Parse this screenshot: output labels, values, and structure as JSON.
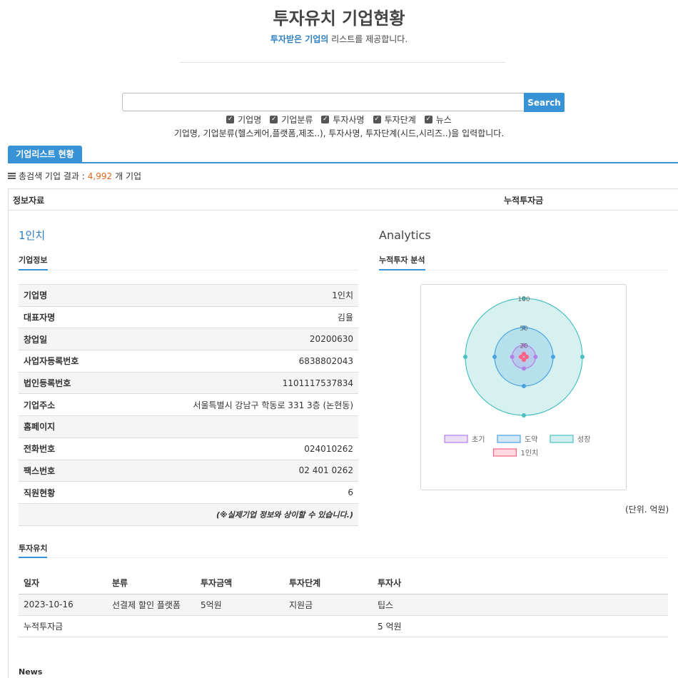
{
  "page": {
    "title": "투자유치 기업현황",
    "subtitle_highlight": "투자받은 기업의",
    "subtitle_rest": " 리스트를 제공합니다."
  },
  "search": {
    "value": "",
    "placeholder": "",
    "button_label": "Search",
    "filters": [
      {
        "label": "기업명",
        "checked": true
      },
      {
        "label": "기업분류",
        "checked": true
      },
      {
        "label": "투자사명",
        "checked": true
      },
      {
        "label": "투자단계",
        "checked": true
      },
      {
        "label": "뉴스",
        "checked": true
      }
    ],
    "help_text": "기업명, 기업분류(헬스케어,플랫폼,제조..), 투자사명, 투자단계(시드,시리즈..)을 입력합니다."
  },
  "list_tab": {
    "label": "기업리스트 현황"
  },
  "results": {
    "prefix": "총검색 기업 결과 : ",
    "count": "4,992",
    "suffix": "개 기업"
  },
  "info_header": {
    "left": "정보자료",
    "right": "누적투자금"
  },
  "company": {
    "name": "1인치",
    "section_label": "기업정보",
    "rows": [
      {
        "key": "기업명",
        "value": "1인치"
      },
      {
        "key": "대표자명",
        "value": "김율"
      },
      {
        "key": "창업일",
        "value": "20200630"
      },
      {
        "key": "사업자등록번호",
        "value": "6838802043"
      },
      {
        "key": "법인등록번호",
        "value": "1101117537834"
      },
      {
        "key": "기업주소",
        "value": "서울특별시 강남구 학동로 331 3층 (논현동)"
      },
      {
        "key": "홈페이지",
        "value": ""
      },
      {
        "key": "전화번호",
        "value": "024010262"
      },
      {
        "key": "팩스번호",
        "value": "02 401 0262"
      },
      {
        "key": "직원현황",
        "value": "6"
      }
    ],
    "disclaimer": "(※실제기업 정보와 상이할 수 있습니다.)"
  },
  "analytics": {
    "title": "Analytics",
    "section_label": "누적투자 분석",
    "unit_note": "(단위. 억원)"
  },
  "chart_data": {
    "type": "radar",
    "axes": [
      "",
      "",
      "",
      ""
    ],
    "r_max": 100,
    "tick_labels": [
      "100",
      "50",
      "20"
    ],
    "series": [
      {
        "name": "초기",
        "values": [
          20,
          20,
          20,
          20
        ],
        "color": "#b47fe6"
      },
      {
        "name": "도약",
        "values": [
          50,
          50,
          50,
          50
        ],
        "color": "#4aa3e0"
      },
      {
        "name": "성장",
        "values": [
          100,
          100,
          100,
          100
        ],
        "color": "#4bc0c0"
      },
      {
        "name": "1인치",
        "values": [
          5,
          5,
          5,
          5
        ],
        "color": "#ff6384"
      }
    ],
    "legend_position": "bottom"
  },
  "investment": {
    "section_label": "투자유치",
    "headers": [
      "일자",
      "분류",
      "투자금액",
      "투자단계",
      "투자사"
    ],
    "rows": [
      [
        "2023-10-16",
        "선결제 할인 플랫폼",
        "5억원",
        "지원금",
        "팁스"
      ]
    ],
    "total_label": "누적투자금",
    "total_value": "5 억원"
  },
  "news": {
    "section_label": "News"
  }
}
